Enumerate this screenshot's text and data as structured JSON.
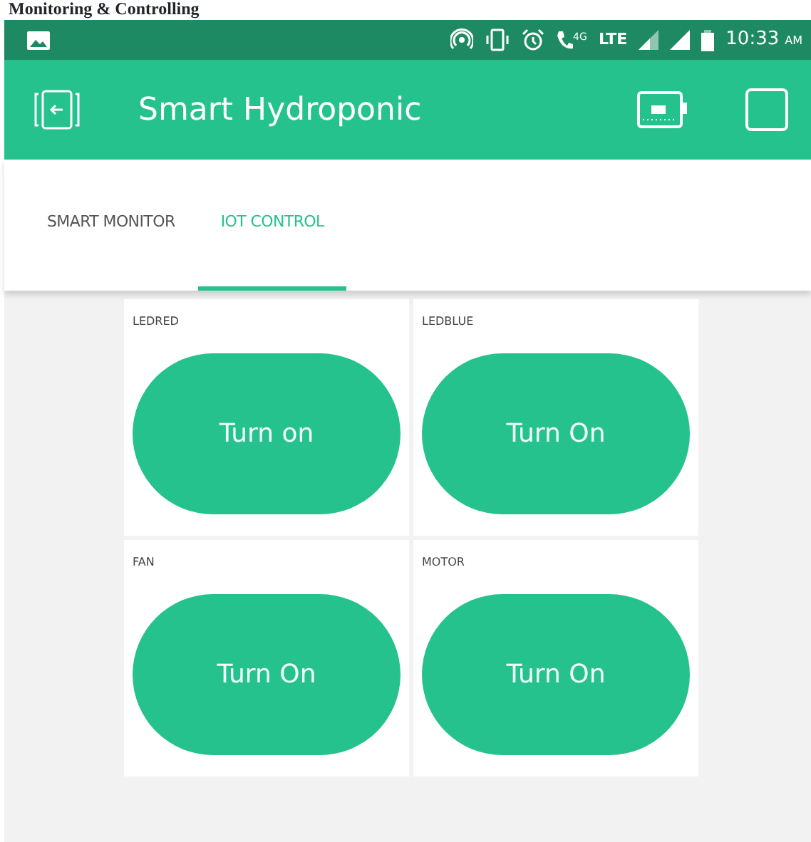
{
  "document_heading": "Monitoring & Controlling",
  "status_bar": {
    "network": "LTE",
    "call_label": "4G",
    "time": "10:33",
    "ampm": "AM"
  },
  "app_bar": {
    "title": "Smart Hydroponic"
  },
  "tabs": [
    {
      "label": "SMART MONITOR",
      "selected": false
    },
    {
      "label": "IOT CONTROL",
      "selected": true
    }
  ],
  "widgets": [
    {
      "label": "LEDRED",
      "button": "Turn on"
    },
    {
      "label": "LEDBLUE",
      "button": "Turn On"
    },
    {
      "label": "FAN",
      "button": "Turn On"
    },
    {
      "label": "MOTOR",
      "button": "Turn On"
    }
  ]
}
